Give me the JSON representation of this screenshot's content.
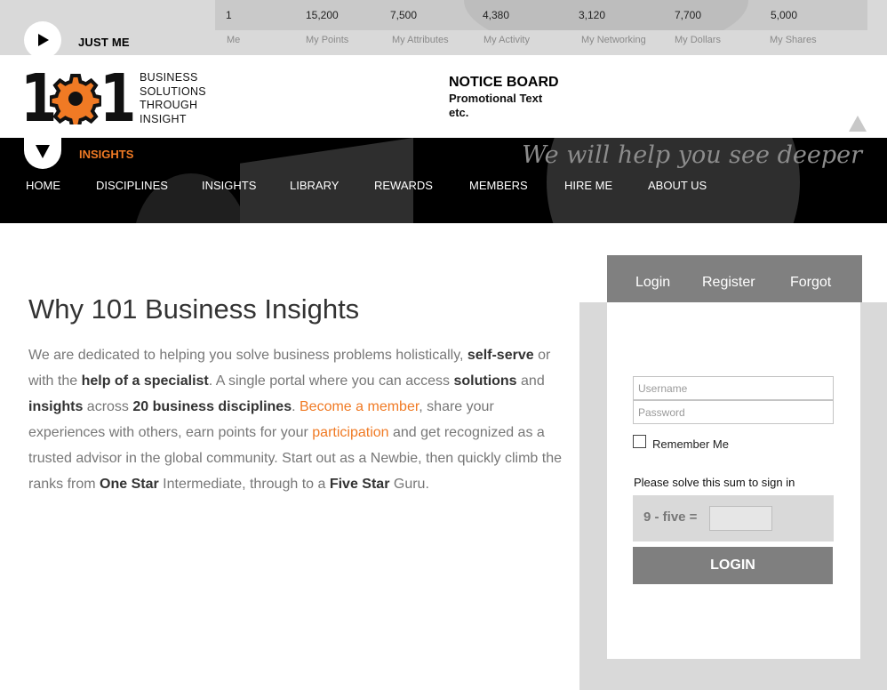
{
  "top_bar": {
    "label": "JUST ME",
    "play_icon": "play-icon",
    "stats": [
      {
        "value": "1",
        "label": "Me"
      },
      {
        "value": "15,200",
        "label": "My Points"
      },
      {
        "value": "7,500",
        "label": "My Attributes"
      },
      {
        "value": "4,380",
        "label": "My Activity"
      },
      {
        "value": "3,120",
        "label": "My Networking"
      },
      {
        "value": "7,700",
        "label": "My Dollars"
      },
      {
        "value": "5,000",
        "label": "My Shares"
      }
    ]
  },
  "logo": {
    "digit_left": "1",
    "digit_right": "1",
    "gear_color": "#f07a24",
    "tagline": [
      "BUSINESS",
      "SOLUTIONS",
      "THROUGH",
      "INSIGHT"
    ]
  },
  "notice": {
    "title": "NOTICE BOARD",
    "text": "Promotional Text etc."
  },
  "nav": {
    "section_label": "INSIGHTS",
    "slogan": "We will help you see deeper",
    "items": [
      "HOME",
      "DISCIPLINES",
      "INSIGHTS",
      "LIBRARY",
      "REWARDS",
      "MEMBERS",
      "HIRE ME",
      "ABOUT US"
    ]
  },
  "content": {
    "title": "Why 101 Business Insights",
    "p": [
      "We are dedicated to helping you solve business problems holistically, ",
      "self-serve",
      " or with the ",
      "help of a specialist",
      ". A single portal where you can access ",
      "solutions",
      " and ",
      "insights",
      " across ",
      "20 business disciplines",
      ". ",
      "Become a member",
      ", share your experiences with others, earn points for your ",
      "participation",
      " and get recognized as a trusted advisor in the global community. Start out as a Newbie, then quickly climb the ranks from ",
      "One Star",
      " Intermediate, through to a ",
      "Five Star",
      " Guru."
    ]
  },
  "login": {
    "tabs": [
      "Login",
      "Register",
      "Forgot"
    ],
    "username_placeholder": "Username",
    "password_placeholder": "Password",
    "remember_label": "Remember Me",
    "sum_hint": "Please solve this sum to sign in",
    "sum_question": "9 - five =",
    "button_label": "LOGIN"
  },
  "colors": {
    "accent": "#f07a24",
    "nav_bg": "#000000",
    "panel_grey": "#808080"
  }
}
